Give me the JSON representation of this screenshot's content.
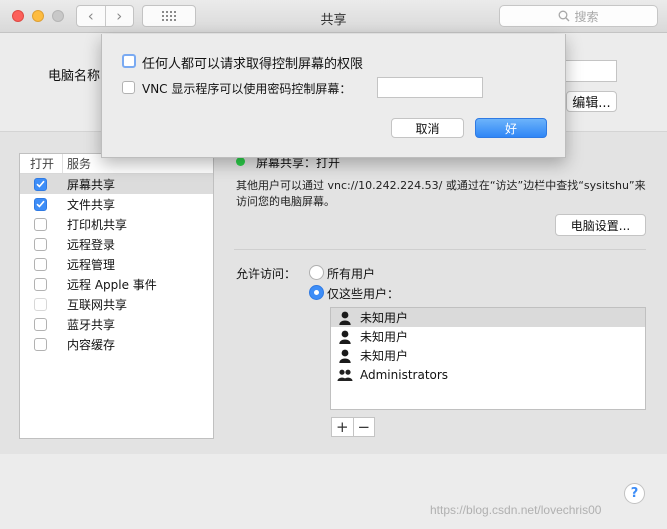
{
  "window": {
    "title": "共享",
    "search_placeholder": "搜索"
  },
  "toolbar": {
    "back_glyph": "‹",
    "forward_glyph": "›"
  },
  "upper": {
    "pc_name_label": "电脑名称",
    "edit_label": "编辑..."
  },
  "services": {
    "header_on": "打开",
    "header_service": "服务",
    "items": [
      {
        "label": "屏幕共享",
        "checked": true,
        "selected": true
      },
      {
        "label": "文件共享",
        "checked": true,
        "selected": false
      },
      {
        "label": "打印机共享",
        "checked": false,
        "selected": false
      },
      {
        "label": "远程登录",
        "checked": false,
        "selected": false
      },
      {
        "label": "远程管理",
        "checked": false,
        "selected": false
      },
      {
        "label": "远程 Apple 事件",
        "checked": false,
        "selected": false
      },
      {
        "label": "互联网共享",
        "checked": false,
        "selected": false,
        "disabled": true
      },
      {
        "label": "蓝牙共享",
        "checked": false,
        "selected": false
      },
      {
        "label": "内容缓存",
        "checked": false,
        "selected": false
      }
    ]
  },
  "detail": {
    "status": "屏幕共享：打开",
    "status_color": "#2ccf4a",
    "description": "其他用户可以通过 vnc://10.242.224.53/ 或通过在“访达”边栏中查找“sysitshu”来访问您的电脑屏幕。",
    "computer_settings_label": "电脑设置...",
    "access_label": "允许访问：",
    "radio_all": "所有用户",
    "radio_only": "仅这些用户：",
    "users": [
      {
        "name": "未知用户",
        "icon": "user-icon",
        "selected": true
      },
      {
        "name": "未知用户",
        "icon": "user-icon",
        "selected": false
      },
      {
        "name": "未知用户",
        "icon": "user-icon",
        "selected": false
      },
      {
        "name": "Administrators",
        "icon": "group-icon",
        "selected": false
      }
    ],
    "add_label": "+",
    "remove_label": "−"
  },
  "sheet": {
    "option1": "任何人都可以请求取得控制屏幕的权限",
    "option2": "VNC 显示程序可以使用密码控制屏幕：",
    "cancel_label": "取消",
    "ok_label": "好"
  },
  "footer": {
    "help_label": "?",
    "watermark": "https://blog.csdn.net/lovechris00"
  },
  "colors": {
    "accent": "#3d8df7"
  }
}
